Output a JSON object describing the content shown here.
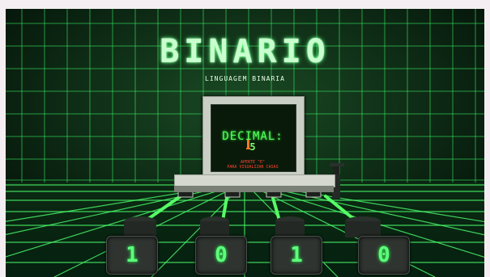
{
  "game": {
    "title": "BINARIO",
    "subtitle": "LINGUAGEM BINARIA"
  },
  "monitor": {
    "label": "DECIMAL:",
    "value": "5",
    "hint_line1": "APERTE \"E\"",
    "hint_line2": "PARA VISUALIZAR CASAS"
  },
  "bits": [
    {
      "label": "1"
    },
    {
      "label": "0"
    },
    {
      "label": "1"
    },
    {
      "label": "0"
    }
  ],
  "colors": {
    "grid": "#3cff6a",
    "background": "#04120a",
    "accent": "#5dff7c",
    "hint": "#ff4433"
  }
}
